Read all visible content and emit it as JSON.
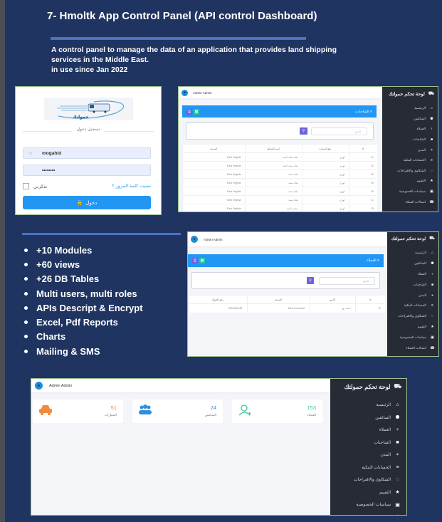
{
  "document": {
    "title": "7- Hmoltk App Control Panel (API control Dashboard)",
    "description_lines": [
      "A control panel to manage the data of an application that provides land shipping",
      "services in the Middle East.",
      "in use since Jan 2022"
    ],
    "features": [
      "+10 Modules",
      "+60 views",
      "+26 DB Tables",
      "Multi users, multi roles",
      "APIs Descript & Encrypt",
      "Excel, Pdf Reports",
      "Charts",
      "Mailing & SMS"
    ],
    "colors": {
      "background": "#1f3461",
      "accent_rule": "#4a73c1",
      "primary": "#2196f3",
      "sidebar": "#262b35"
    }
  },
  "login": {
    "logo_text": "حمولتك",
    "section_label": "تسجيل دخول",
    "username_value": "mogahid",
    "password_value": "••••••••",
    "remember_label": "تذكرني",
    "forgot_label": "نسيت كلمة المرور ؟",
    "submit_label": "دخول"
  },
  "app": {
    "brand": "لوحة تحكم حمولتك",
    "user_name": "Admin Admin",
    "sidebar_items": [
      {
        "label": "الرئيسية",
        "icon": "home-icon"
      },
      {
        "label": "السائقين",
        "icon": "users-icon"
      },
      {
        "label": "العملاء",
        "icon": "user-icon"
      },
      {
        "label": "الشاحنات",
        "icon": "truck-icon"
      },
      {
        "label": "المدن",
        "icon": "map-marker-icon"
      },
      {
        "label": "الحسابات البنكية",
        "icon": "bank-icon"
      },
      {
        "label": "الشكاوى والاقتراحات",
        "icon": "comments-icon"
      },
      {
        "label": "التقييم",
        "icon": "star-icon"
      },
      {
        "label": "سياسات الخصوصية",
        "icon": "lock-icon"
      },
      {
        "label": "اتصالات العملاء",
        "icon": "phone-icon"
      }
    ]
  },
  "trucks_page": {
    "card_title": "الشاحنات",
    "search_placeholder": "الاسم",
    "columns": [
      "#",
      "نوع السيارة",
      "اسم السائق",
      "المدينة"
    ],
    "rows": [
      [
        "31",
        "لوري",
        "ملك سعد احمد",
        "East Virginia"
      ],
      [
        "31",
        "لوري",
        "ملك سعد احمد",
        "East Virginia"
      ],
      [
        "28",
        "لوري",
        "ملك سعد",
        "East Virginia"
      ],
      [
        "29",
        "لوري",
        "ملك سعد",
        "East Virginia"
      ],
      [
        "30",
        "لوري",
        "ملك سعد",
        "East Virginia"
      ],
      [
        "21",
        "لوري",
        "ملك سعد",
        "East Virginia"
      ],
      [
        "23",
        "لوري",
        "محمد احمد",
        "East Virginia"
      ]
    ]
  },
  "clients_page": {
    "card_title": "العملاء",
    "search_placeholder": "الاسم",
    "columns": [
      "#",
      "الاسم",
      "المدينة",
      "رقم الجوال"
    ],
    "rows": [
      [
        "10",
        "احمد نور",
        "East Cumarfort",
        "0502984182"
      ]
    ]
  },
  "home_page": {
    "stats": [
      {
        "value": "153",
        "label": "العملاء",
        "icon": "user-plus-icon",
        "color": "#3ec5a0"
      },
      {
        "value": "24",
        "label": "السائقين",
        "icon": "users-icon",
        "color": "#2f8fde"
      },
      {
        "value": "51",
        "label": "السيارات",
        "icon": "car-icon",
        "color": "#f08a3e"
      }
    ]
  }
}
